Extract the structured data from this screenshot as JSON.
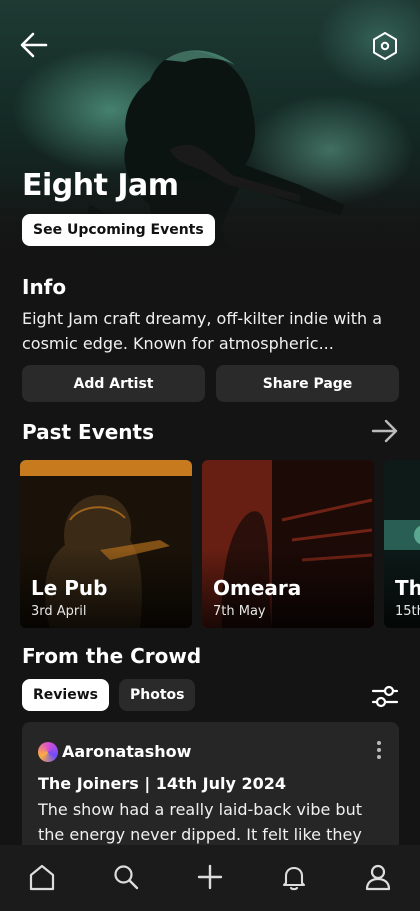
{
  "hero": {
    "artist_name": "Eight Jam",
    "upcoming_button": "See Upcoming Events",
    "back_icon": "arrow-left-icon",
    "settings_icon": "hexagon-icon"
  },
  "info": {
    "title": "Info",
    "text": "Eight Jam craft dreamy, off-kilter indie with a cosmic edge. Known for atmospheric..."
  },
  "actions": {
    "add_artist": "Add Artist",
    "share_page": "Share Page"
  },
  "past_events": {
    "title": "Past Events",
    "items": [
      {
        "venue": "Le Pub",
        "date": "3rd April",
        "tint": "#c77a1e"
      },
      {
        "venue": "Omeara",
        "date": "7th May",
        "tint": "#a8321e"
      },
      {
        "venue": "Th",
        "date": "15th",
        "tint": "#3a8c7c"
      }
    ]
  },
  "crowd": {
    "title": "From the Crowd",
    "tabs": [
      "Reviews",
      "Photos"
    ],
    "review": {
      "user": "Aaronatashow",
      "heading": "The Joiners | 14th July 2024",
      "text": "The show had a really laid-back vibe but the energy never dipped.  It felt like they"
    }
  },
  "nav": [
    "home-icon",
    "search-icon",
    "plus-icon",
    "bell-icon",
    "user-icon"
  ],
  "colors": {
    "accent": "#6fc4a8",
    "background": "#141414",
    "card": "#262626"
  }
}
